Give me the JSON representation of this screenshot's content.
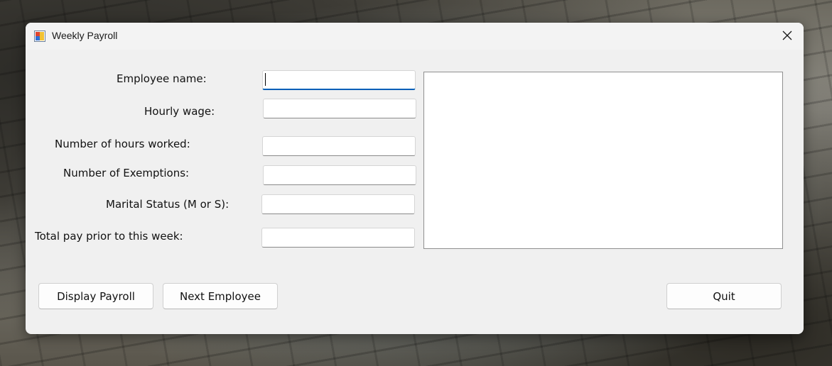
{
  "window": {
    "title": "Weekly Payroll"
  },
  "icons": {
    "app": "app-form-icon",
    "close": "close-icon"
  },
  "form": {
    "employee_name": {
      "label": "Employee name:",
      "value": ""
    },
    "hourly_wage": {
      "label": "Hourly wage:",
      "value": ""
    },
    "hours_worked": {
      "label": "Number of hours worked:",
      "value": ""
    },
    "exemptions": {
      "label": "Number of Exemptions:",
      "value": ""
    },
    "marital_status": {
      "label": "Marital Status (M or S):",
      "value": ""
    },
    "prior_pay": {
      "label": "Total pay prior to this week:",
      "value": ""
    }
  },
  "output": {
    "text": ""
  },
  "buttons": {
    "display_payroll": "Display Payroll",
    "next_employee": "Next Employee",
    "quit": "Quit"
  },
  "colors": {
    "focus_accent": "#005fb8",
    "window_bg": "#f0f0f0"
  }
}
